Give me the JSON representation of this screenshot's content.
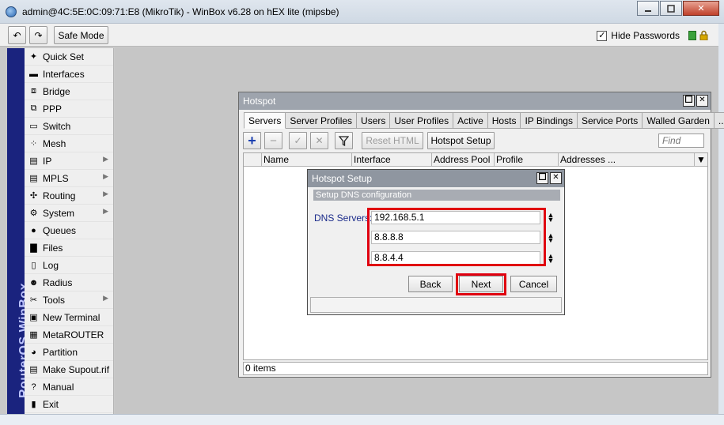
{
  "window": {
    "title": "admin@4C:5E:0C:09:71:E8 (MikroTik) - WinBox v6.28 on hEX lite (mipsbe)",
    "min_icon": "minimize-icon",
    "max_icon": "maximize-icon",
    "close_glyph": "✕"
  },
  "toolbar": {
    "undo_glyph": "↶",
    "redo_glyph": "↷",
    "safe_mode_label": "Safe Mode",
    "hide_passwords_label": "Hide Passwords",
    "hide_passwords_checked": "✓"
  },
  "sidebar": {
    "brand_text": "RouterOS WinBox",
    "items": [
      {
        "label": "Quick Set",
        "icon": "wand-icon",
        "glyph": "✦",
        "arrow": ""
      },
      {
        "label": "Interfaces",
        "icon": "interfaces-icon",
        "glyph": "▬",
        "arrow": ""
      },
      {
        "label": "Bridge",
        "icon": "bridge-icon",
        "glyph": "⧈",
        "arrow": ""
      },
      {
        "label": "PPP",
        "icon": "ppp-icon",
        "glyph": "⧉",
        "arrow": ""
      },
      {
        "label": "Switch",
        "icon": "switch-icon",
        "glyph": "▭",
        "arrow": ""
      },
      {
        "label": "Mesh",
        "icon": "mesh-icon",
        "glyph": "⁘",
        "arrow": ""
      },
      {
        "label": "IP",
        "icon": "ip-icon",
        "glyph": "▤",
        "arrow": "▶"
      },
      {
        "label": "MPLS",
        "icon": "mpls-icon",
        "glyph": "▤",
        "arrow": "▶"
      },
      {
        "label": "Routing",
        "icon": "routing-icon",
        "glyph": "✣",
        "arrow": "▶"
      },
      {
        "label": "System",
        "icon": "gear-icon",
        "glyph": "⚙",
        "arrow": "▶"
      },
      {
        "label": "Queues",
        "icon": "queues-icon",
        "glyph": "●",
        "arrow": ""
      },
      {
        "label": "Files",
        "icon": "folder-icon",
        "glyph": "▇",
        "arrow": ""
      },
      {
        "label": "Log",
        "icon": "log-icon",
        "glyph": "▯",
        "arrow": ""
      },
      {
        "label": "Radius",
        "icon": "radius-icon",
        "glyph": "☻",
        "arrow": ""
      },
      {
        "label": "Tools",
        "icon": "tools-icon",
        "glyph": "✂",
        "arrow": "▶"
      },
      {
        "label": "New Terminal",
        "icon": "terminal-icon",
        "glyph": "▣",
        "arrow": ""
      },
      {
        "label": "MetaROUTER",
        "icon": "metarouter-icon",
        "glyph": "▦",
        "arrow": ""
      },
      {
        "label": "Partition",
        "icon": "partition-icon",
        "glyph": "◕",
        "arrow": ""
      },
      {
        "label": "Make Supout.rif",
        "icon": "document-icon",
        "glyph": "▤",
        "arrow": ""
      },
      {
        "label": "Manual",
        "icon": "help-icon",
        "glyph": "?",
        "arrow": ""
      },
      {
        "label": "Exit",
        "icon": "exit-icon",
        "glyph": "▮",
        "arrow": ""
      }
    ]
  },
  "hotspot": {
    "title": "Hotspot",
    "tabs": [
      "Servers",
      "Server Profiles",
      "Users",
      "User Profiles",
      "Active",
      "Hosts",
      "IP Bindings",
      "Service Ports",
      "Walled Garden",
      "..."
    ],
    "active_tab": "Servers",
    "toolbar": {
      "add_glyph": "+",
      "remove_glyph": "−",
      "enable_glyph": "✓",
      "disable_glyph": "✕",
      "filter_glyph": "▼",
      "reset_html_label": "Reset HTML",
      "setup_label": "Hotspot Setup",
      "find_placeholder": "Find"
    },
    "columns": [
      "Name",
      "Interface",
      "Address Pool",
      "Profile",
      "Addresses ..."
    ],
    "status": "0 items"
  },
  "setup_dialog": {
    "title": "Hotspot Setup",
    "section": "Setup DNS configuration",
    "dns_label": "DNS Servers:",
    "dns_servers": [
      "192.168.5.1",
      "8.8.8.8",
      "8.8.4.4"
    ],
    "back_label": "Back",
    "next_label": "Next",
    "cancel_label": "Cancel"
  },
  "colors": {
    "accent_red": "#e00010",
    "brand_bar": "#1a237e",
    "add_icon_blue": "#1a3fb0"
  }
}
